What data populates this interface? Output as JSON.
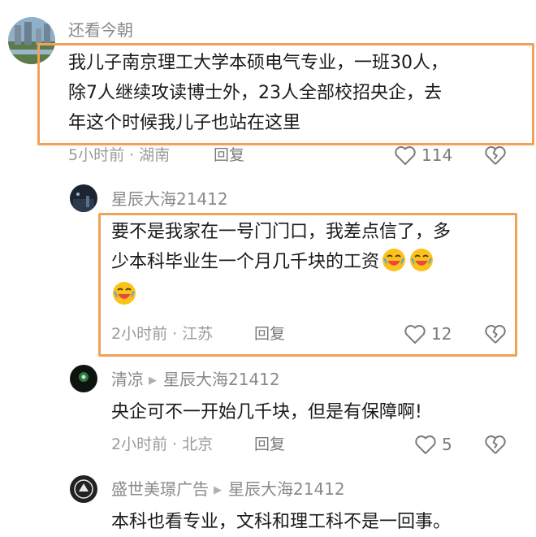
{
  "comments": [
    {
      "username": "还看今朝",
      "lines": [
        "我儿子南京理工大学本硕电气专业，一班30人，",
        "除7人继续攻读博士外，23人全部校招央企，去",
        "年这个时候我儿子也站在这里"
      ],
      "time": "5小时前",
      "location": "湖南",
      "reply_label": "回复",
      "likes": "114"
    },
    {
      "username": "星辰大海21412",
      "lines": [
        "要不是我家在一号门门口，我差点信了，多",
        "少本科毕业生一个月几千块的工资"
      ],
      "emoji_icon": "crying-laughing-emoji",
      "time": "2小时前",
      "location": "江苏",
      "reply_label": "回复",
      "likes": "12"
    },
    {
      "username": "清凉",
      "reply_to": "星辰大海21412",
      "lines": [
        "央企可不一开始几千块，但是有保障啊!"
      ],
      "time": "2小时前",
      "location": "北京",
      "reply_label": "回复",
      "likes": "5"
    },
    {
      "username": "盛世美璟广告",
      "reply_to": "星辰大海21412",
      "lines": [
        "本科也看专业，文科和理工科不是一回事。"
      ]
    }
  ],
  "colors": {
    "highlight": "#f0a257",
    "meta": "#9a9a9a",
    "text": "#1a1a1a"
  }
}
